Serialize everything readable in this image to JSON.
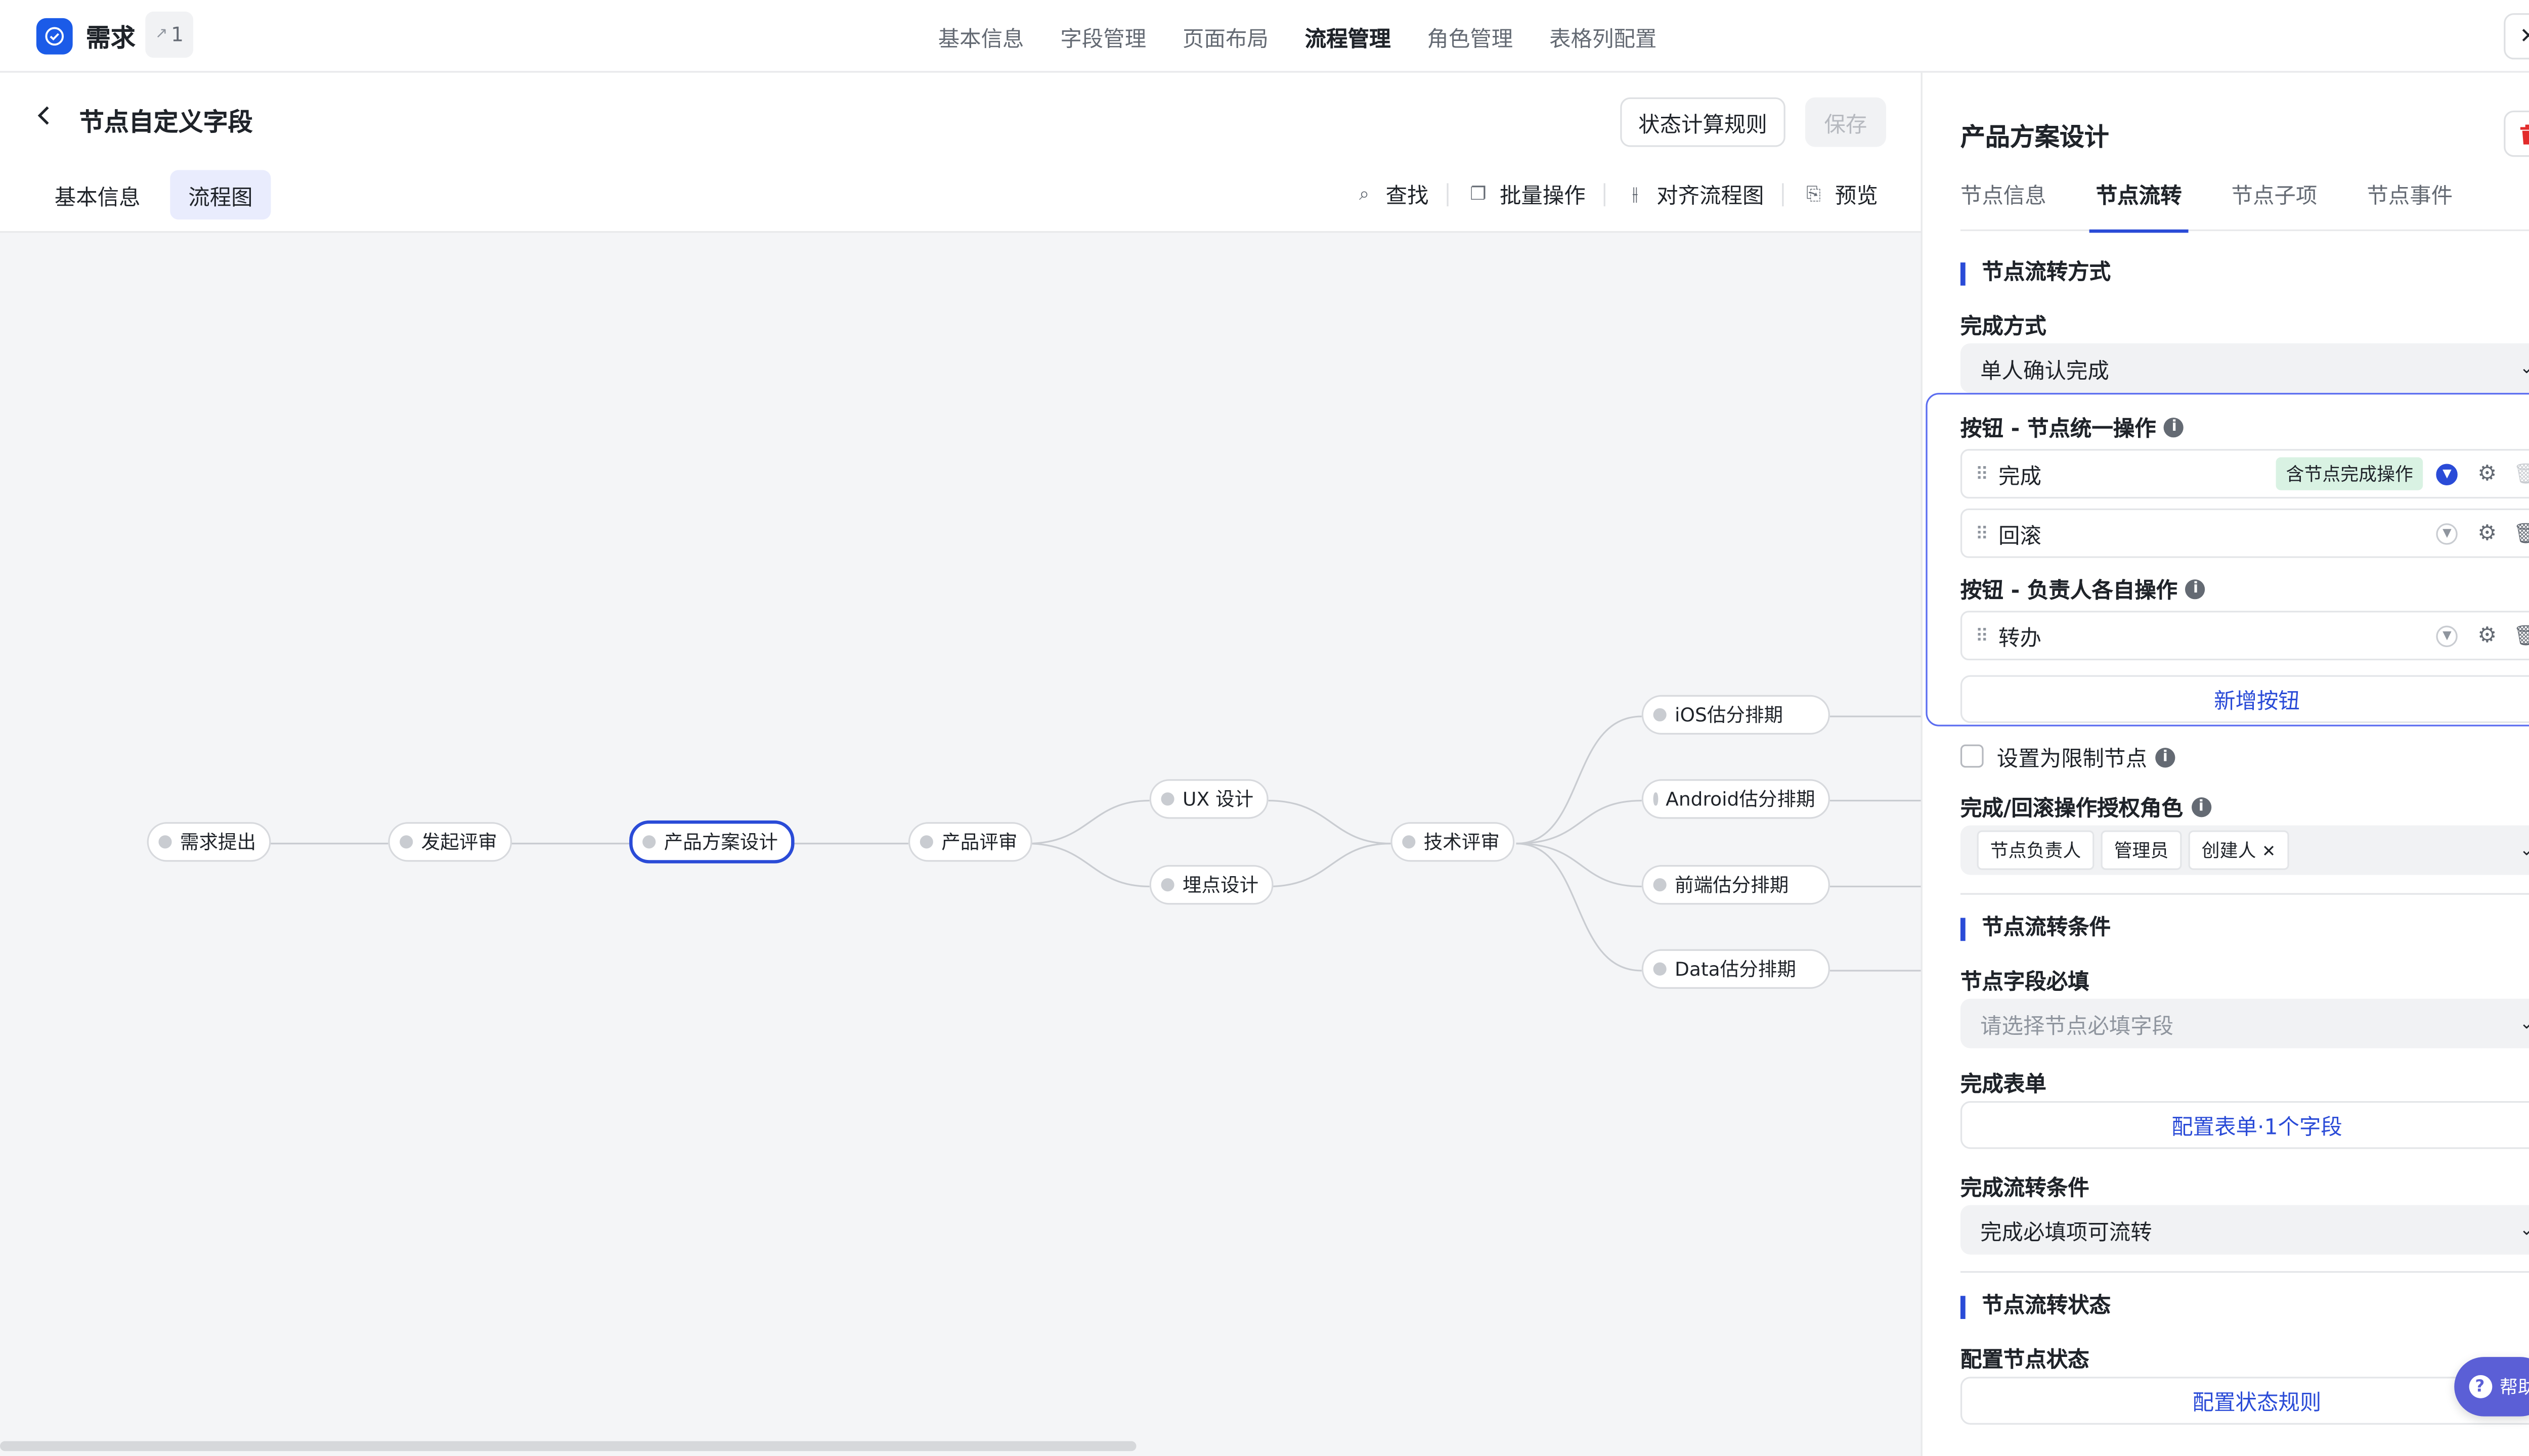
{
  "app": {
    "title": "需求",
    "share_count": "1",
    "close_glyph": "✕"
  },
  "top_tabs": [
    {
      "label": "基本信息"
    },
    {
      "label": "字段管理"
    },
    {
      "label": "页面布局"
    },
    {
      "label": "流程管理",
      "active": true
    },
    {
      "label": "角色管理"
    },
    {
      "label": "表格列配置"
    }
  ],
  "header": {
    "title": "节点自定义字段",
    "rule_button": "状态计算规则",
    "save_button": "保存"
  },
  "subtabs": [
    {
      "label": "基本信息"
    },
    {
      "label": "流程图",
      "active": true
    }
  ],
  "toolbar": {
    "find": "查找",
    "batch": "批量操作",
    "align": "对齐流程图",
    "preview": "预览"
  },
  "flow_nodes": [
    {
      "id": "n1",
      "label": "需求提出"
    },
    {
      "id": "n2",
      "label": "发起评审"
    },
    {
      "id": "n3",
      "label": "产品方案设计",
      "selected": true
    },
    {
      "id": "n4",
      "label": "产品评审"
    },
    {
      "id": "n5",
      "label": "UX 设计"
    },
    {
      "id": "n6",
      "label": "埋点设计"
    },
    {
      "id": "n7",
      "label": "技术评审"
    },
    {
      "id": "n8",
      "label": "iOS估分排期"
    },
    {
      "id": "n9",
      "label": "Android估分排期"
    },
    {
      "id": "n10",
      "label": "前端估分排期"
    },
    {
      "id": "n11",
      "label": "Data估分排期"
    }
  ],
  "panel": {
    "title": "产品方案设计",
    "tabs": [
      {
        "label": "节点信息"
      },
      {
        "label": "节点流转",
        "active": true
      },
      {
        "label": "节点子项"
      },
      {
        "label": "节点事件"
      }
    ],
    "section1": "节点流转方式",
    "complete_mode_label": "完成方式",
    "complete_mode_value": "单人确认完成",
    "unified_ops_label": "按钮 - 节点统一操作",
    "unified_buttons": [
      {
        "label": "完成",
        "badge": "含节点完成操作"
      },
      {
        "label": "回滚"
      }
    ],
    "owner_ops_label": "按钮 - 负责人各自操作",
    "owner_buttons": [
      {
        "label": "转办"
      }
    ],
    "add_button": "新增按钮",
    "restrict_label": "设置为限制节点",
    "roles_label": "完成/回滚操作授权角色",
    "roles": [
      "节点负责人",
      "管理员",
      "创建人"
    ],
    "section2": "节点流转条件",
    "required_fields_label": "节点字段必填",
    "required_fields_placeholder": "请选择节点必填字段",
    "form_label": "完成表单",
    "form_button": "配置表单·1个字段",
    "flow_cond_label": "完成流转条件",
    "flow_cond_value": "完成必填项可流转",
    "section3": "节点流转状态",
    "status_label": "配置节点状态",
    "status_button": "配置状态规则"
  },
  "help": {
    "label": "帮助"
  },
  "colors": {
    "accent": "#2a4bd7",
    "brand": "#1b5be8",
    "danger": "#e22a2a",
    "badge_green": "#d9f2e3"
  }
}
